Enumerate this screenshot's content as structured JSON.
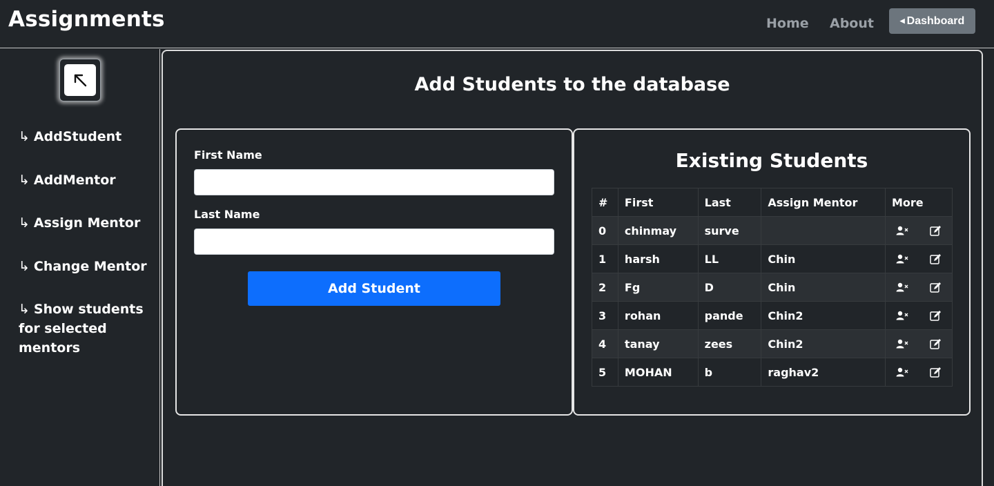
{
  "navbar": {
    "brand": "Assignments",
    "home": "Home",
    "about": "About",
    "dashboard": "Dashboard"
  },
  "sidebar": {
    "toggle_icon": "arrow-up-left-icon",
    "items": [
      {
        "label": "AddStudent"
      },
      {
        "label": "AddMentor"
      },
      {
        "label": "Assign Mentor"
      },
      {
        "label": "Change Mentor"
      },
      {
        "label": "Show students for selected mentors"
      }
    ]
  },
  "main": {
    "title": "Add Students to the database",
    "form": {
      "first_name_label": "First Name",
      "first_name_value": "",
      "last_name_label": "Last Name",
      "last_name_value": "",
      "submit_label": "Add Student"
    },
    "students": {
      "title": "Existing Students",
      "columns": [
        "#",
        "First",
        "Last",
        "Assign Mentor",
        "More"
      ],
      "rows": [
        {
          "num": "0",
          "first": "chinmay",
          "last": "surve",
          "mentor": ""
        },
        {
          "num": "1",
          "first": "harsh",
          "last": "LL",
          "mentor": "Chin"
        },
        {
          "num": "2",
          "first": "Fg",
          "last": "D",
          "mentor": "Chin"
        },
        {
          "num": "3",
          "first": "rohan",
          "last": "pande",
          "mentor": "Chin2"
        },
        {
          "num": "4",
          "first": "tanay",
          "last": "zees",
          "mentor": "Chin2"
        },
        {
          "num": "5",
          "first": "MOHAN",
          "last": "b",
          "mentor": "raghav2"
        }
      ],
      "row_icons": [
        "person-x-icon",
        "edit-icon"
      ]
    }
  },
  "colors": {
    "background": "#212529",
    "primary": "#0d6efd",
    "secondary": "#6c757d"
  }
}
